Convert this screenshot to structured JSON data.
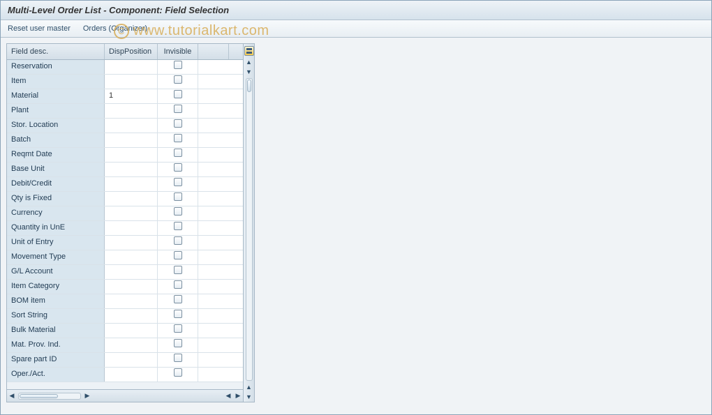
{
  "title": "Multi-Level Order List - Component: Field Selection",
  "toolbar": {
    "reset_label": "Reset user master",
    "orders_label": "Orders (Organizer)"
  },
  "watermark": {
    "symbol": "C",
    "text": "www.tutorialkart.com"
  },
  "grid": {
    "headers": {
      "desc": "Field desc.",
      "pos": "DispPosition",
      "inv": "Invisible"
    },
    "config_tooltip": "Configure",
    "rows": [
      {
        "desc": "Reservation",
        "pos": "",
        "inv": false
      },
      {
        "desc": "Item",
        "pos": "",
        "inv": false
      },
      {
        "desc": "Material",
        "pos": "1",
        "inv": false
      },
      {
        "desc": "Plant",
        "pos": "",
        "inv": false
      },
      {
        "desc": "Stor. Location",
        "pos": "",
        "inv": false
      },
      {
        "desc": "Batch",
        "pos": "",
        "inv": false
      },
      {
        "desc": "Reqmt Date",
        "pos": "",
        "inv": false
      },
      {
        "desc": "Base Unit",
        "pos": "",
        "inv": false
      },
      {
        "desc": "Debit/Credit",
        "pos": "",
        "inv": false
      },
      {
        "desc": "Qty is Fixed",
        "pos": "",
        "inv": false
      },
      {
        "desc": "Currency",
        "pos": "",
        "inv": false
      },
      {
        "desc": "Quantity in UnE",
        "pos": "",
        "inv": false
      },
      {
        "desc": "Unit of Entry",
        "pos": "",
        "inv": false
      },
      {
        "desc": "Movement Type",
        "pos": "",
        "inv": false
      },
      {
        "desc": "G/L Account",
        "pos": "",
        "inv": false
      },
      {
        "desc": "Item Category",
        "pos": "",
        "inv": false
      },
      {
        "desc": "BOM item",
        "pos": "",
        "inv": false
      },
      {
        "desc": "Sort String",
        "pos": "",
        "inv": false
      },
      {
        "desc": "Bulk Material",
        "pos": "",
        "inv": false
      },
      {
        "desc": "Mat. Prov. Ind.",
        "pos": "",
        "inv": false
      },
      {
        "desc": "Spare part ID",
        "pos": "",
        "inv": false
      },
      {
        "desc": "Oper./Act.",
        "pos": "",
        "inv": false
      }
    ]
  }
}
